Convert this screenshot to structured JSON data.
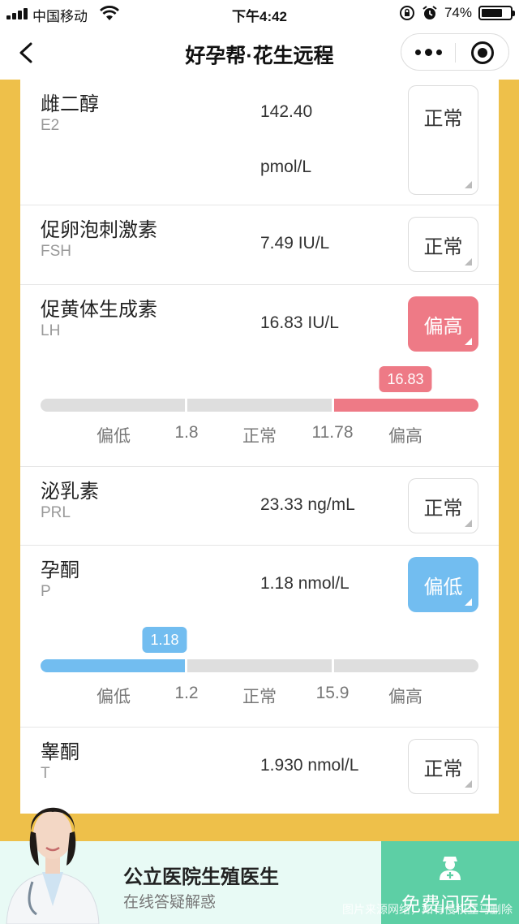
{
  "status_bar": {
    "carrier": "中国移动",
    "time": "下午4:42",
    "battery": "74%",
    "battery_level": 0.74
  },
  "nav": {
    "title": "好孕帮·花生远程"
  },
  "results": [
    {
      "name": "雌二醇",
      "abbr": "E2",
      "value": "142.40",
      "unit": "pmol/L",
      "status": "正常"
    },
    {
      "name": "促卵泡刺激素",
      "abbr": "FSH",
      "value": "7.49 IU/L",
      "status": "正常"
    },
    {
      "name": "促黄体生成素",
      "abbr": "LH",
      "value": "16.83 IU/L",
      "status": "偏高",
      "range": {
        "marker": "16.83",
        "labels": [
          "偏低",
          "1.8",
          "正常",
          "11.78",
          "偏高"
        ]
      }
    },
    {
      "name": "泌乳素",
      "abbr": "PRL",
      "value": "23.33 ng/mL",
      "status": "正常"
    },
    {
      "name": "孕酮",
      "abbr": "P",
      "value": "1.18 nmol/L",
      "status": "偏低",
      "range": {
        "marker": "1.18",
        "labels": [
          "偏低",
          "1.2",
          "正常",
          "15.9",
          "偏高"
        ]
      }
    },
    {
      "name": "睾酮",
      "abbr": "T",
      "value": "1.930 nmol/L",
      "status": "正常"
    }
  ],
  "banner": {
    "title": "公立医院生殖医生",
    "subtitle": "在线答疑解惑",
    "cta": "免费问医生",
    "watermark": "图片来源网络，如有侵权立马删除"
  },
  "colors": {
    "accent_yellow": "#EEC04A",
    "high": "#EE7A86",
    "low": "#72BDF0",
    "cta_green": "#5DCFA5"
  }
}
